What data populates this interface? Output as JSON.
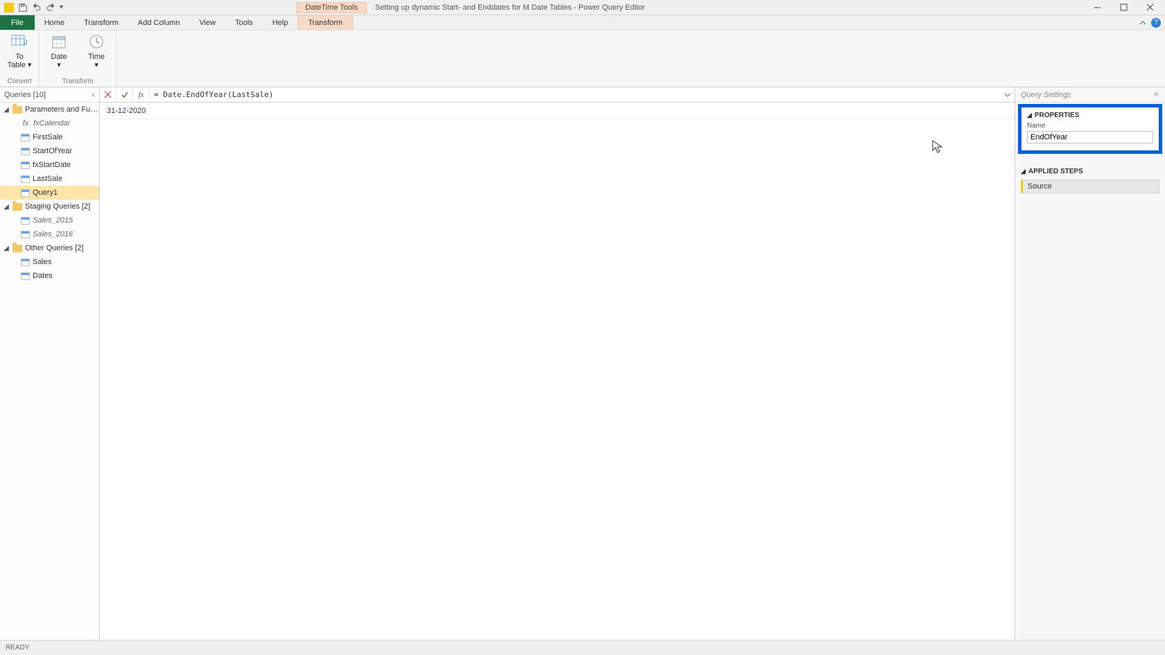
{
  "title_bar": {
    "contextual_group": "DateTime Tools",
    "window_title": "Setting up dynamic Start- and Enddates for M Date Tables - Power Query Editor"
  },
  "ribbon_tabs": {
    "file": "File",
    "home": "Home",
    "transform": "Transform",
    "add_column": "Add Column",
    "view": "View",
    "tools": "Tools",
    "help": "Help",
    "contextual_transform": "Transform"
  },
  "ribbon_body": {
    "to_table": {
      "line1": "To",
      "line2": "Table ▾"
    },
    "date": {
      "label": "Date",
      "drop": "▾"
    },
    "time": {
      "label": "Time",
      "drop": "▾"
    },
    "group_convert": "Convert",
    "group_transform": "Transform"
  },
  "queries_pane": {
    "header": "Queries [10]",
    "groups": {
      "params": "Parameters and Fu…",
      "staging": "Staging Queries [2]",
      "other": "Other Queries [2]"
    },
    "items": {
      "fxCalendar": "fxCalendar",
      "FirstSale": "FirstSale",
      "StartOfYear": "StartOfYear",
      "fxStartDate": "fxStartDate",
      "LastSale": "LastSale",
      "Query1": "Query1",
      "Sales_2015": "Sales_2015",
      "Sales_2016": "Sales_2016",
      "Sales": "Sales",
      "Dates": "Dates"
    }
  },
  "formula_bar": {
    "value": "= Date.EndOfYear(LastSale)"
  },
  "preview": {
    "row0": "31-12-2020"
  },
  "settings": {
    "title": "Query Settings",
    "properties_header": "PROPERTIES",
    "name_label": "Name",
    "name_value": "EndOfYear",
    "applied_header": "APPLIED STEPS",
    "steps": {
      "source": "Source"
    }
  },
  "status_bar": {
    "ready": "READY"
  }
}
